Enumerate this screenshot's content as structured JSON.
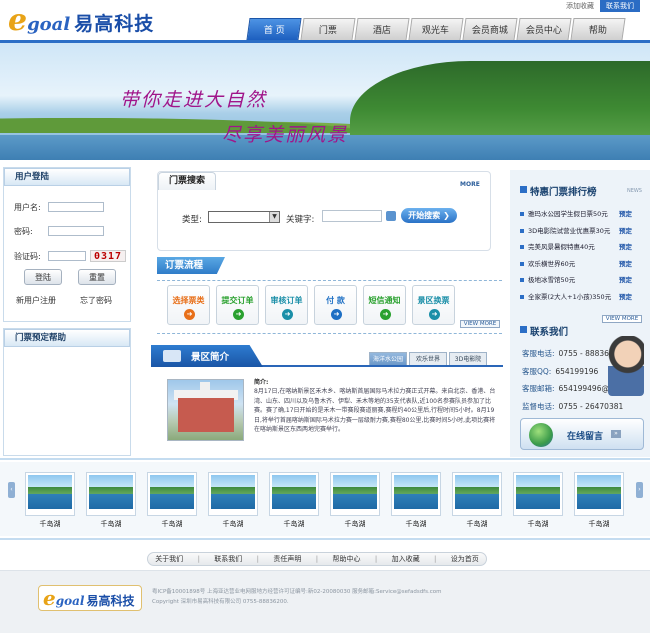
{
  "brand": {
    "logo_e": "e",
    "logo_goal": "goal",
    "logo_cn": "易高科技"
  },
  "top_links": {
    "favorite": "添加收藏",
    "contact": "联系我们"
  },
  "nav": [
    {
      "label": "首 页",
      "active": true
    },
    {
      "label": "门票"
    },
    {
      "label": "酒店"
    },
    {
      "label": "观光车"
    },
    {
      "label": "会员商城"
    },
    {
      "label": "会员中心"
    },
    {
      "label": "帮助"
    }
  ],
  "banner": {
    "slogan_1": "带你走进大自然",
    "slogan_2": "尽享美丽风景"
  },
  "login": {
    "title": "用户登陆",
    "username_label": "用户名:",
    "password_label": "密码:",
    "captcha_label": "验证码:",
    "captcha_value": "0317",
    "login_button": "登陆",
    "reset_button": "重置",
    "register_link": "新用户注册",
    "forgot_link": "忘了密码"
  },
  "help": {
    "title": "门票预定帮助"
  },
  "search": {
    "title": "门票搜索",
    "more": "MORE",
    "type_label": "类型:",
    "keyword_label": "关键字:",
    "button": "开始搜索"
  },
  "flow": {
    "title": "订票流程",
    "more": "VIEW MORE",
    "steps": [
      {
        "label": "选择票类",
        "color": "#e8701a"
      },
      {
        "label": "提交订单",
        "color": "#2aa12f"
      },
      {
        "label": "审核订单",
        "color": "#1b8fa8"
      },
      {
        "label": "付 款",
        "color": "#1d6fc4"
      },
      {
        "label": "短信通知",
        "color": "#2aa12f"
      },
      {
        "label": "景区换票",
        "color": "#1b8fa8"
      }
    ]
  },
  "intro": {
    "title": "景区简介",
    "tabs": [
      "海洋水公园",
      "欢乐世界",
      "3D电影院"
    ],
    "heading": "简介:",
    "text": "8月17日,在喀纳斯景区禾木乡、喀纳斯首届国际马术拉力赛正式开幕。来自北京、香港、台湾、山东、四川以及乌鲁木齐、伊犁、禾木等地的35支代表队,近100名参赛队员参加了比赛。赛了确,17日开始的是禾木一带赛段赛道丽赛,赛程约40公里后,行程时间5小时。8月19日,将举行首届喀纳斯国际马术拉力赛一层级耐力赛,赛程80公里,比赛时间5小时,此项比赛将在喀纳斯景区东西两地完赛举行。"
  },
  "ranking": {
    "title": "特惠门票排行榜",
    "en": "NEWS",
    "more": "VIEW MORE",
    "items": [
      {
        "name": "雅玛水公园学生假日票50元",
        "action": "预定"
      },
      {
        "name": "3D电影院试营业优惠票30元",
        "action": "预定"
      },
      {
        "name": "完美风景暑假特惠40元",
        "action": "预定"
      },
      {
        "name": "欢乐横世界60元",
        "action": "预定"
      },
      {
        "name": "极地冰雪馆50元",
        "action": "预定"
      },
      {
        "name": "全家票(2大人+1小孩)350元",
        "action": "预定"
      }
    ]
  },
  "contact": {
    "title": "联系我们",
    "rows": [
      {
        "label": "客服电话:",
        "value": "0755 - 88836200"
      },
      {
        "label": "客服QQ:",
        "value": "654199196"
      },
      {
        "label": "客服邮箱:",
        "value": "654199496@qq.com"
      },
      {
        "label": "监督电话:",
        "value": "0755 - 26470381"
      }
    ],
    "online_button": "在线留言"
  },
  "gallery": {
    "items": [
      "千岛湖",
      "千岛湖",
      "千岛湖",
      "千岛湖",
      "千岛湖",
      "千岛湖",
      "千岛湖",
      "千岛湖",
      "千岛湖",
      "千岛湖"
    ]
  },
  "footer_links": [
    "关于我们",
    "联系我们",
    "责任声明",
    "帮助中心",
    "加入收藏",
    "设为首页"
  ],
  "footer": {
    "line1": "粤ICP备10001898号 上海亚达营业电网服地方经营许可证编号:新02-20080030 服务邮箱:Service@sefadsdfs.com",
    "line2": "Copyright 深圳市易高科技有限公司 0755-88836200."
  },
  "colors": {
    "accent": "#2c6ec6",
    "slogan": "#a0158a",
    "logo_orange": "#e8a317"
  }
}
